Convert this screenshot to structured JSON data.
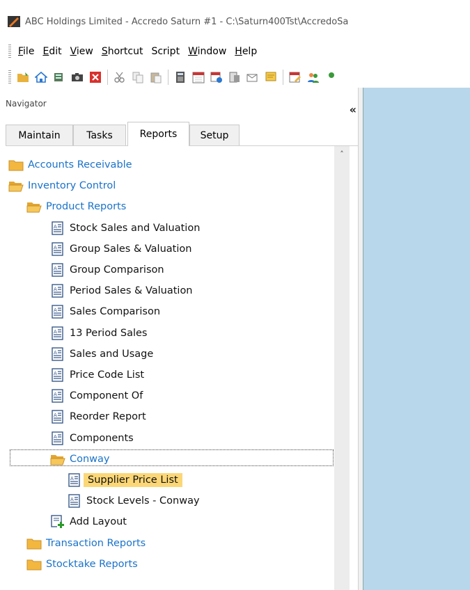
{
  "window": {
    "title": "ABC Holdings Limited - Accredo Saturn #1 - C:\\Saturn400Tst\\AccredoSa"
  },
  "menu": [
    {
      "underline": "F",
      "rest": "ile"
    },
    {
      "underline": "E",
      "rest": "dit"
    },
    {
      "underline": "V",
      "rest": "iew"
    },
    {
      "underline": "S",
      "rest": "hortcut"
    },
    {
      "underline": "",
      "rest": "Script"
    },
    {
      "underline": "W",
      "rest": "indow"
    },
    {
      "underline": "H",
      "rest": "elp"
    }
  ],
  "navigator": {
    "title": "Navigator",
    "collapse_glyph": "«"
  },
  "tabs": [
    {
      "label": "Maintain",
      "active": false
    },
    {
      "label": "Tasks",
      "active": false
    },
    {
      "label": "Reports",
      "active": true
    },
    {
      "label": "Setup",
      "active": false
    }
  ],
  "tree": [
    {
      "label": "Accounts Receivable",
      "type": "folder",
      "open": false,
      "level": 0
    },
    {
      "label": "Inventory Control",
      "type": "folder",
      "open": true,
      "level": 0
    },
    {
      "label": "Product Reports",
      "type": "folder",
      "open": true,
      "level": 1
    },
    {
      "label": "Stock Sales and Valuation",
      "type": "report",
      "level": 2
    },
    {
      "label": "Group Sales & Valuation",
      "type": "report",
      "level": 2
    },
    {
      "label": "Group Comparison",
      "type": "report",
      "level": 2
    },
    {
      "label": "Period Sales & Valuation",
      "type": "report",
      "level": 2
    },
    {
      "label": "Sales Comparison",
      "type": "report",
      "level": 2
    },
    {
      "label": "13 Period Sales",
      "type": "report",
      "level": 2
    },
    {
      "label": "Sales and Usage",
      "type": "report",
      "level": 2
    },
    {
      "label": "Price Code List",
      "type": "report",
      "level": 2
    },
    {
      "label": "Component Of",
      "type": "report",
      "level": 2
    },
    {
      "label": "Reorder Report",
      "type": "report",
      "level": 2
    },
    {
      "label": "Components",
      "type": "report",
      "level": 2
    },
    {
      "label": "Conway",
      "type": "folder",
      "open": true,
      "level": 2
    },
    {
      "label": "Supplier Price List",
      "type": "report",
      "level": 3,
      "selected": true
    },
    {
      "label": "Stock Levels - Conway",
      "type": "report",
      "level": 3
    },
    {
      "label": "Add Layout",
      "type": "add",
      "level": 2
    },
    {
      "label": "Transaction Reports",
      "type": "folder",
      "open": false,
      "level": 1
    },
    {
      "label": "Stocktake Reports",
      "type": "folder",
      "open": false,
      "level": 1
    }
  ],
  "colors": {
    "folder_text": "#1a73c9",
    "selection": "#fbd777",
    "right_pane": "#b9d7ea"
  }
}
